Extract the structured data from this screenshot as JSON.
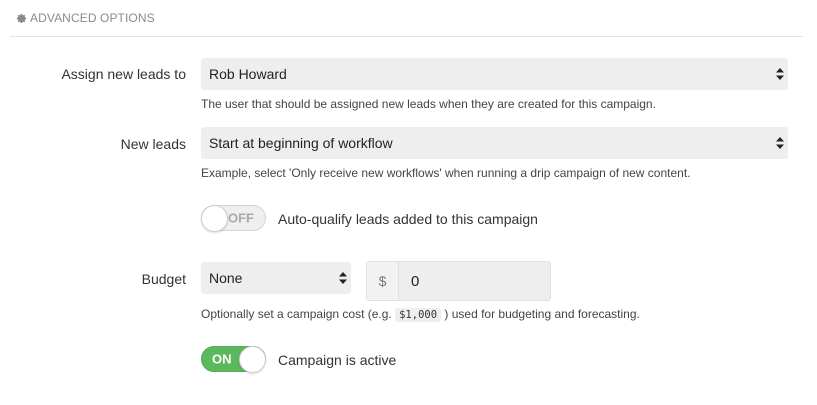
{
  "section": {
    "title": "ADVANCED OPTIONS",
    "icon": "gear-icon"
  },
  "assign_leads": {
    "label": "Assign new leads to",
    "value": "Rob Howard",
    "help": "The user that should be assigned new leads when they are created for this campaign."
  },
  "new_leads": {
    "label": "New leads",
    "value": "Start at beginning of workflow",
    "help": "Example, select 'Only receive new workflows' when running a drip campaign of new content."
  },
  "auto_qualify": {
    "state": "OFF",
    "caption": "Auto-qualify leads added to this campaign"
  },
  "budget": {
    "label": "Budget",
    "select_value": "None",
    "currency": "$",
    "amount": "0",
    "help_prefix": "Optionally set a campaign cost (e.g.",
    "help_example": "$1,000",
    "help_suffix": ") used for budgeting and forecasting."
  },
  "active": {
    "state": "ON",
    "caption": "Campaign is active"
  },
  "colors": {
    "toggle_on": "#5cb85c",
    "select_bg": "#eeeeee",
    "section_title": "#8a8a8a"
  }
}
